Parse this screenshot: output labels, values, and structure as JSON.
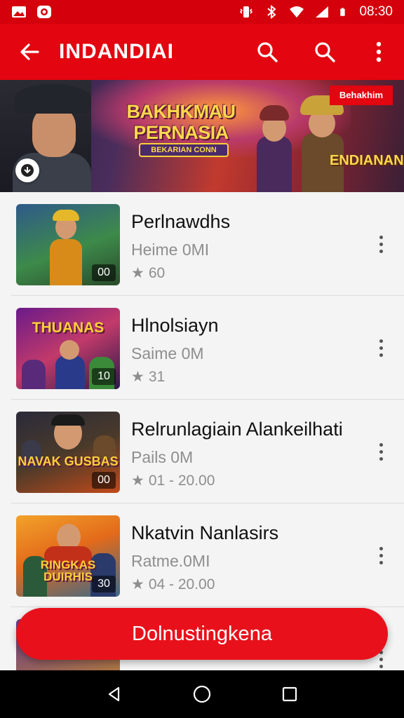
{
  "status_bar": {
    "time": "08:30",
    "icons_left": [
      "gallery-icon",
      "app-notification-icon"
    ],
    "icons_right": [
      "vibrate-icon",
      "bluetooth-icon",
      "wifi-icon",
      "signal-icon",
      "battery-icon"
    ]
  },
  "app_bar": {
    "title": "INDANDIAI",
    "actions": [
      "search-icon",
      "search-icon",
      "more-vertical-icon"
    ]
  },
  "banner": {
    "title": "BAKHKMAU PERNASIA",
    "subtitle": "BEKARIAN CONN",
    "badge": "Behakhim",
    "corner_text": "ENDIANAN"
  },
  "items": [
    {
      "title": "Perlnawdhs",
      "subtitle": "Heime 0MI",
      "meta": "60",
      "thumb_count": "00",
      "thumb_label": ""
    },
    {
      "title": "Hlnolsiayn",
      "subtitle": "Saime 0M",
      "meta": "31",
      "thumb_count": "10",
      "thumb_label": "THUANAS"
    },
    {
      "title": "Relrunlagiain Alankeilhati",
      "subtitle": "Pails 0M",
      "meta": "01 - 20.00",
      "thumb_count": "00",
      "thumb_label": "NAVAK GUSBAS"
    },
    {
      "title": "Nkatvin Nanlasirs",
      "subtitle": "Ratme.0MI",
      "meta": "04 - 20.00",
      "thumb_count": "30",
      "thumb_label": "RINGKAS DUIRHIS"
    }
  ],
  "action_button": {
    "label": "Dolnustingkena"
  },
  "colors": {
    "primary": "#e3050f",
    "status_bar": "#d4000b",
    "text_primary": "#111111",
    "text_secondary": "#8e8e8e"
  }
}
